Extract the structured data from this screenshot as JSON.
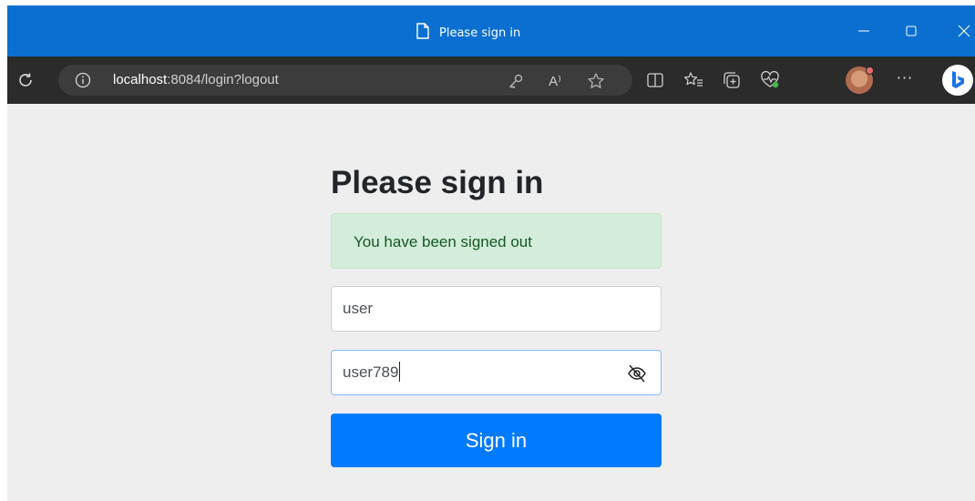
{
  "browser": {
    "window_title": "Please sign in",
    "address": {
      "host": "localhost",
      "rest": ":8084/login?logout"
    },
    "read_aloud_label": "A⁾",
    "more_label": "···"
  },
  "login": {
    "heading": "Please sign in",
    "alert": "You have been signed out",
    "username_value": "user",
    "password_value": "user789",
    "submit_label": "Sign in"
  },
  "colors": {
    "titlebar": "#0a6fd1",
    "toolbar": "#2b2b2b",
    "page_bg": "#eeeeee",
    "alert_bg": "#d4edda",
    "alert_text": "#155724",
    "primary": "#007bff"
  },
  "icons": [
    "page-icon",
    "minimize-icon",
    "maximize-icon",
    "close-icon",
    "refresh-icon",
    "info-icon",
    "key-icon",
    "read-aloud-icon",
    "favorite-star-icon",
    "split-screen-icon",
    "favorites-icon",
    "collections-icon",
    "browser-essentials-icon",
    "profile-avatar",
    "more-icon",
    "copilot-icon",
    "hide-password-icon"
  ]
}
